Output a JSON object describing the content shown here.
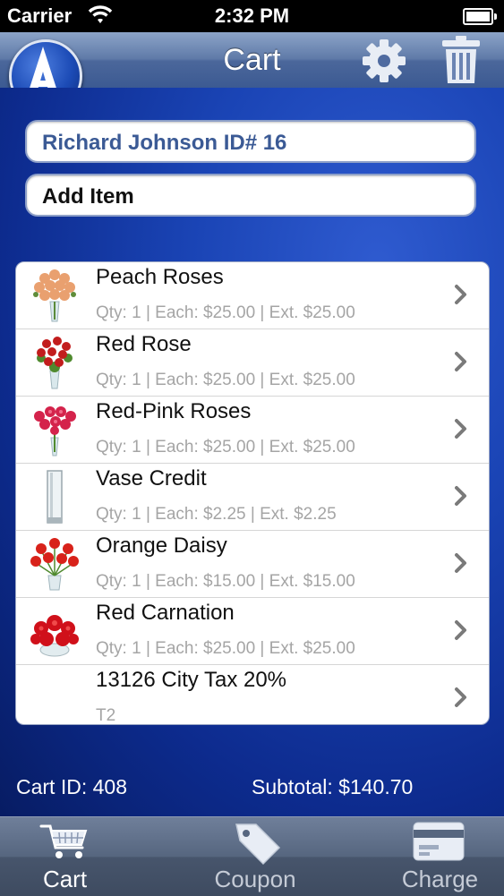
{
  "status_bar": {
    "carrier": "Carrier",
    "time": "2:32 PM"
  },
  "navbar": {
    "title": "Cart",
    "logo_letter": "A",
    "settings_icon": "gear-icon",
    "trash_icon": "trash-icon"
  },
  "customer": {
    "label": "Richard Johnson ID# 16"
  },
  "add_item": {
    "label": "Add Item"
  },
  "items": [
    {
      "name": "Peach Roses",
      "detail": "Qty: 1 | Each: $25.00 | Ext.  $25.00",
      "thumb": "peach-roses",
      "color": "#e9a06f"
    },
    {
      "name": "Red Rose",
      "detail": "Qty: 1 | Each: $25.00 | Ext.  $25.00",
      "thumb": "red-rose",
      "color": "#c21d1d"
    },
    {
      "name": "Red-Pink Roses",
      "detail": "Qty: 1 | Each: $25.00 | Ext.  $25.00",
      "thumb": "red-pink-roses",
      "color": "#d4234b"
    },
    {
      "name": "Vase Credit",
      "detail": "Qty: 1 | Each: $2.25 | Ext.  $2.25",
      "thumb": "vase",
      "color": "#cfd6dc"
    },
    {
      "name": "Orange Daisy",
      "detail": "Qty: 1 | Each: $15.00 | Ext.  $15.00",
      "thumb": "orange-daisy",
      "color": "#d8221a"
    },
    {
      "name": "Red Carnation",
      "detail": "Qty: 1 | Each: $25.00 | Ext.  $25.00",
      "thumb": "red-carnation",
      "color": "#d0101a"
    },
    {
      "name": "13126 City Tax 20%",
      "detail": "T2",
      "thumb": "",
      "color": ""
    }
  ],
  "footer": {
    "cart_id": "Cart ID: 408",
    "subtotal": "Subtotal:  $140.70"
  },
  "tabs": [
    {
      "label": "Cart",
      "icon": "cart-icon",
      "active": true
    },
    {
      "label": "Coupon",
      "icon": "tag-icon",
      "active": false
    },
    {
      "label": "Charge",
      "icon": "credit-card-icon",
      "active": false
    }
  ],
  "colors": {
    "accent": "#3b5a95",
    "background": "#0d2b8e",
    "navbar": "#4b679b",
    "detail_text": "#a5a5a5"
  }
}
